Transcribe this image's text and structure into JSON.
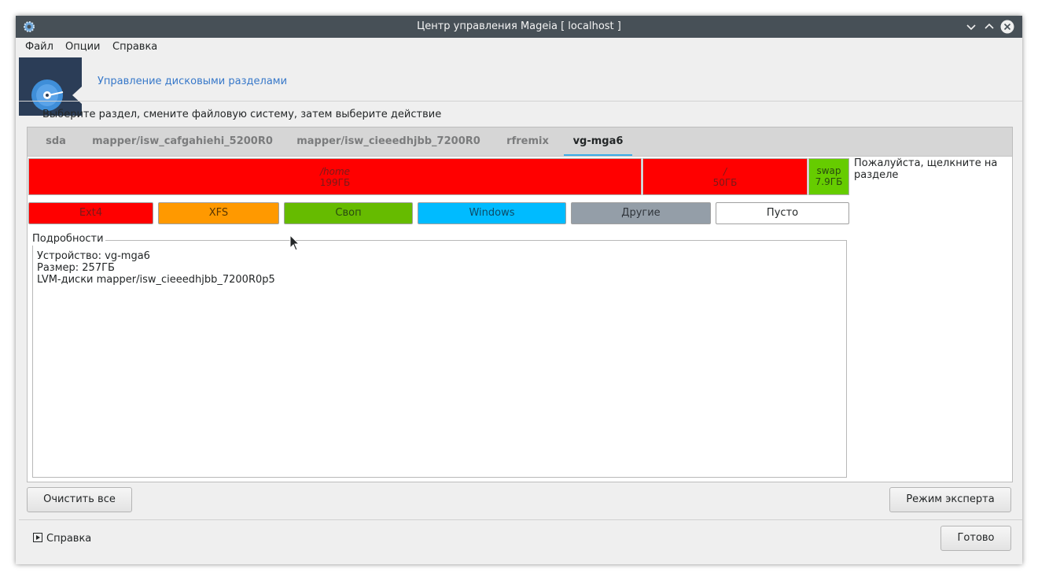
{
  "window": {
    "title": "Центр управления Mageia [ localhost ]"
  },
  "menubar": {
    "items": [
      "Файл",
      "Опции",
      "Справка"
    ]
  },
  "banner": {
    "title": "Управление дисковыми разделами"
  },
  "instruction": "Выберите раздел, смените файловую систему, затем выберите действие",
  "tabs": [
    {
      "label": "sda",
      "active": false
    },
    {
      "label": "mapper/isw_cafgahiehi_5200R0",
      "active": false
    },
    {
      "label": "mapper/isw_cieeedhjbb_7200R0",
      "active": false
    },
    {
      "label": "rfremix",
      "active": false
    },
    {
      "label": "vg-mga6",
      "active": true
    }
  ],
  "partitions": [
    {
      "name": "/home",
      "size": "199ГБ",
      "color": "#ff0000"
    },
    {
      "name": "/",
      "size": "50ГБ",
      "color": "#ff0000"
    },
    {
      "name": "swap",
      "size": "7.9ГБ",
      "color": "#66cc00"
    }
  ],
  "hint": "Пожалуйста, щелкните на разделе",
  "legend": [
    {
      "label": "Ext4",
      "color": "#ff0000"
    },
    {
      "label": "XFS",
      "color": "#ff9900"
    },
    {
      "label": "Своп",
      "color": "#66bb00"
    },
    {
      "label": "Windows",
      "color": "#00bbff"
    },
    {
      "label": "Другие",
      "color": "#949ea8"
    },
    {
      "label": "Пусто",
      "color": "#ffffff"
    }
  ],
  "details": {
    "label": "Подробности",
    "lines": [
      "Устройство: vg-mga6",
      "Размер: 257ГБ",
      "LVM-диски mapper/isw_cieeedhjbb_7200R0p5"
    ]
  },
  "buttons": {
    "clear_all": "Очистить все",
    "expert_mode": "Режим эксперта",
    "done": "Готово"
  },
  "help_expander": "Справка",
  "colors": {
    "titlebar": "#475057",
    "accent": "#3daee9",
    "banner_link": "#3778c9"
  }
}
